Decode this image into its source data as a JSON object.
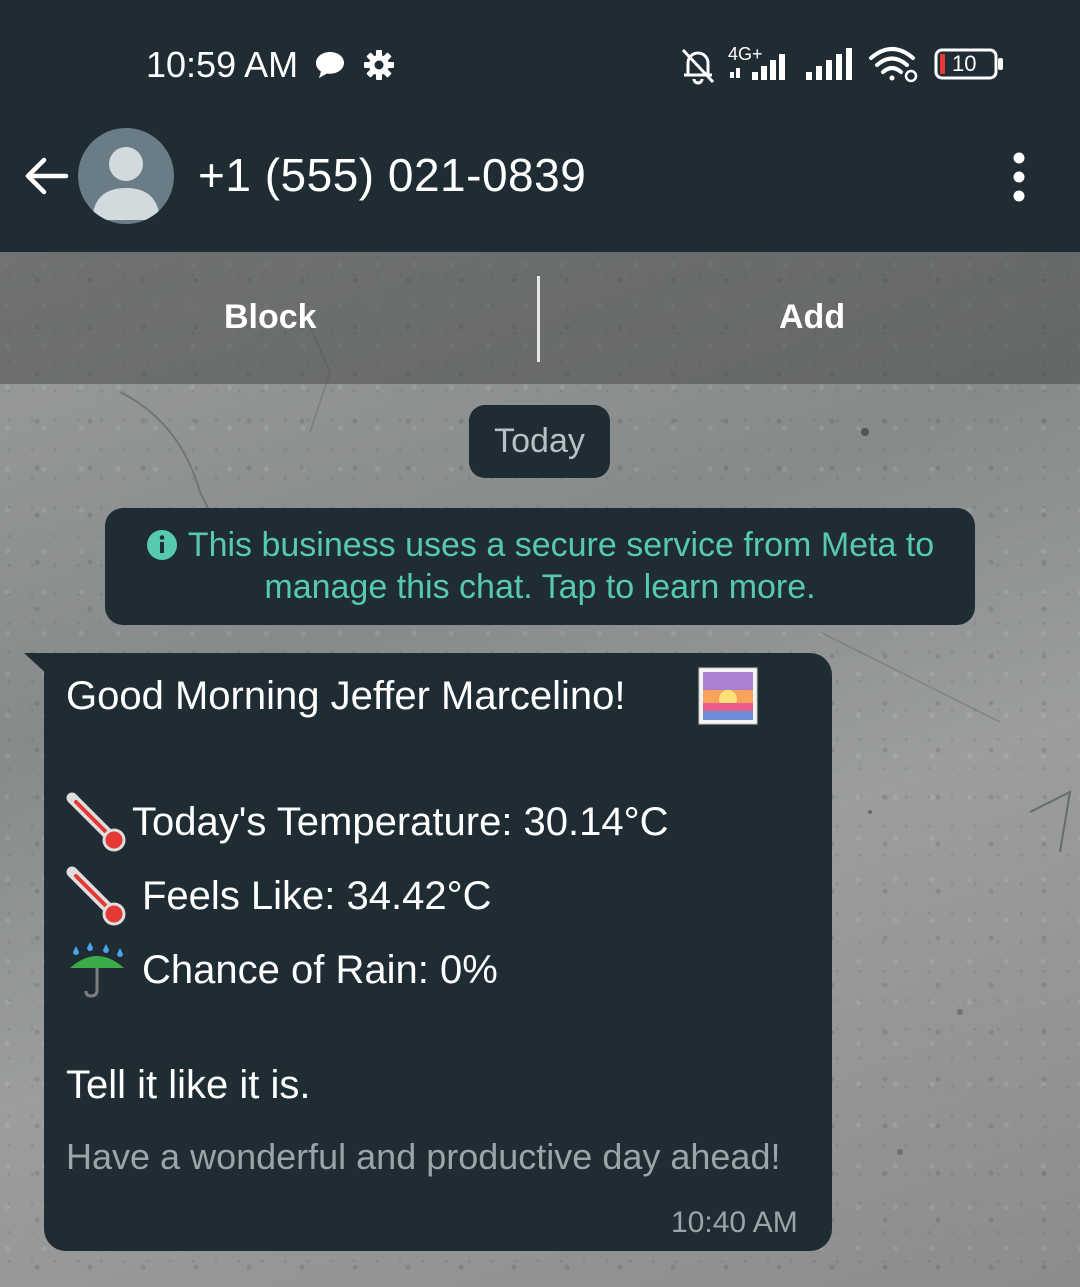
{
  "status_bar": {
    "time": "10:59 AM",
    "network_label": "4G+",
    "battery_level": "10"
  },
  "header": {
    "contact": "+1 (555) 021-0839"
  },
  "actions": {
    "block_label": "Block",
    "add_label": "Add"
  },
  "chat": {
    "date_chip": "Today",
    "info_banner": {
      "line1": "This business uses a secure service from Meta to",
      "line2": "manage this chat. Tap to learn more."
    },
    "message": {
      "greeting": "Good Morning Jeffer Marcelino!",
      "temperature": "Today's Temperature: 30.14°C",
      "feels_like": "Feels Like: 34.42°C",
      "rain": "Chance of Rain: 0%",
      "quote": "Tell it like it is.",
      "closing": "Have a wonderful and productive day ahead!",
      "time": "10:40 AM"
    }
  },
  "icons": {
    "chat_bubble": "chat-bubble-icon",
    "settings": "gear-icon",
    "mute": "bell-off-icon",
    "signal": "signal-icon",
    "wifi": "wifi-icon",
    "battery": "battery-icon",
    "back": "arrow-left-icon",
    "menu": "more-vertical-icon",
    "info": "info-icon",
    "sunrise": "sunrise-emoji",
    "thermometer": "thermometer-emoji",
    "umbrella": "umbrella-rain-emoji"
  },
  "colors": {
    "header_bg": "#1f2c33",
    "bubble_bg": "#1f2c33",
    "info_text": "#58c9b1",
    "battery_low": "#e53935"
  }
}
